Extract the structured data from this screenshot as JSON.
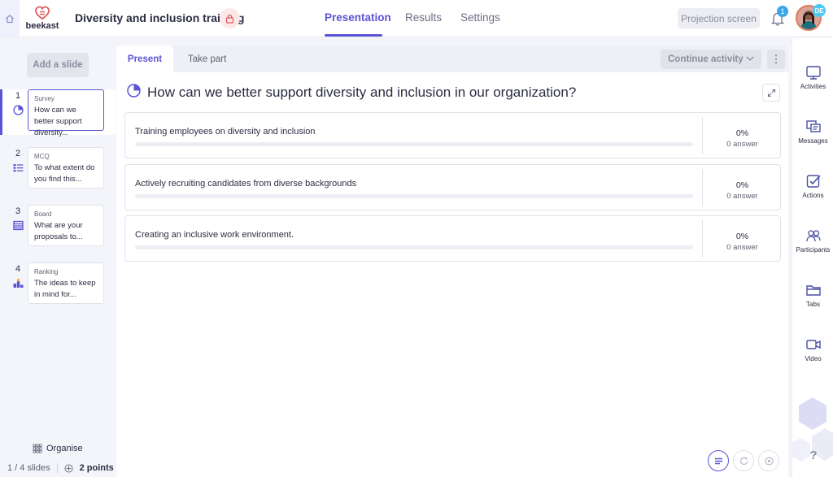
{
  "app": {
    "logo_text": "beekast",
    "doc_title": "Diversity and inclusion training"
  },
  "nav": {
    "tabs": [
      {
        "label": "Presentation",
        "active": true
      },
      {
        "label": "Results",
        "active": false
      },
      {
        "label": "Settings",
        "active": false
      }
    ],
    "projection_label": "Projection screen",
    "notification_count": "1",
    "avatar_initials": "DE"
  },
  "slides_panel": {
    "add_label": "Add a slide",
    "slides": [
      {
        "number": "1",
        "type": "Survey",
        "text": "How can we better support diversity...",
        "icon": "pie-chart-icon",
        "active": true
      },
      {
        "number": "2",
        "type": "MCQ",
        "text": "To what extent do you find this...",
        "icon": "mcq-grid-icon",
        "active": false
      },
      {
        "number": "3",
        "type": "Board",
        "text": "What are your proposals to...",
        "icon": "board-icon",
        "active": false
      },
      {
        "number": "4",
        "type": "Ranking",
        "text": "The ideas to keep in mind for...",
        "icon": "ranking-icon",
        "active": false
      }
    ],
    "organise_label": "Organise",
    "slides_count": "1 / 4 slides",
    "points": "2 points"
  },
  "main": {
    "tabs": [
      {
        "label": "Present",
        "active": true
      },
      {
        "label": "Take part",
        "active": false
      }
    ],
    "continue_label": "Continue activity",
    "more_label": "⋮",
    "question": "How can we better support diversity and inclusion in our organization?",
    "answers": [
      {
        "label": "Training employees on diversity and inclusion",
        "percent": "0%",
        "count": "0 answer",
        "fill": 0
      },
      {
        "label": "Actively recruiting candidates from diverse backgrounds",
        "percent": "0%",
        "count": "0 answer",
        "fill": 0
      },
      {
        "label": "Creating an inclusive work environment.",
        "percent": "0%",
        "count": "0 answer",
        "fill": 0
      }
    ]
  },
  "right_sidebar": {
    "items": [
      {
        "label": "Activities",
        "icon": "activities-icon"
      },
      {
        "label": "Messages",
        "icon": "messages-icon"
      },
      {
        "label": "Actions",
        "icon": "actions-icon"
      },
      {
        "label": "Participants",
        "icon": "participants-icon"
      },
      {
        "label": "Tabs",
        "icon": "folder-icon"
      },
      {
        "label": "Video",
        "icon": "video-icon"
      }
    ],
    "help_label": "?"
  },
  "colors": {
    "accent": "#5b54d6",
    "badge": "#3aa7e9",
    "lock_bg": "#fde8e8",
    "logo": "#e05a5a"
  }
}
